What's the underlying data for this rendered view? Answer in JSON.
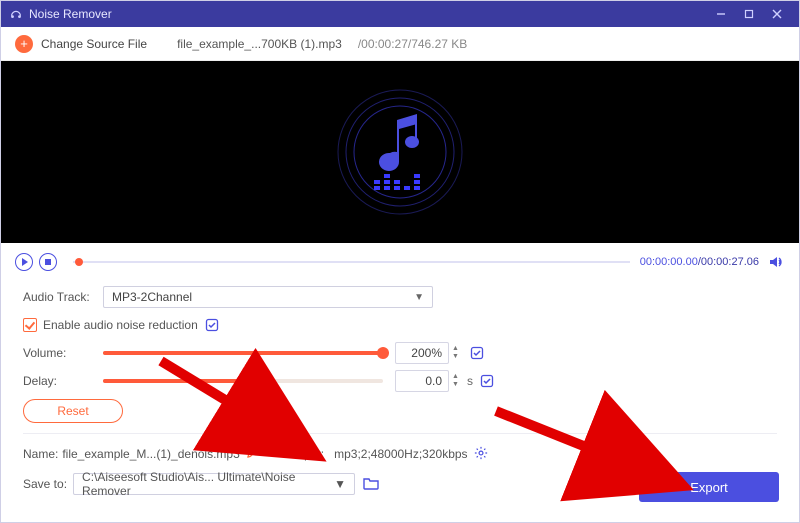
{
  "titlebar": {
    "title": "Noise Remover"
  },
  "sourcebar": {
    "change_label": "Change Source File",
    "filename": "file_example_...700KB (1).mp3",
    "meta": "/00:00:27/746.27 KB"
  },
  "player": {
    "time_current": "00:00:00.00",
    "time_total": "/00:00:27.06"
  },
  "track": {
    "label": "Audio Track:",
    "value": "MP3-2Channel"
  },
  "noise": {
    "label": "Enable audio noise reduction"
  },
  "volume": {
    "label": "Volume:",
    "value": "200%"
  },
  "delay": {
    "label": "Delay:",
    "value": "0.0",
    "unit": "s"
  },
  "reset": {
    "label": "Reset"
  },
  "name": {
    "label": "Name:",
    "value": "file_example_M...(1)_denois.mp3"
  },
  "output": {
    "label": "Output:",
    "value": "mp3;2;48000Hz;320kbps"
  },
  "saveto": {
    "label": "Save to:",
    "value": "C:\\Aiseesoft Studio\\Ais... Ultimate\\Noise Remover"
  },
  "export": {
    "label": "Export"
  }
}
